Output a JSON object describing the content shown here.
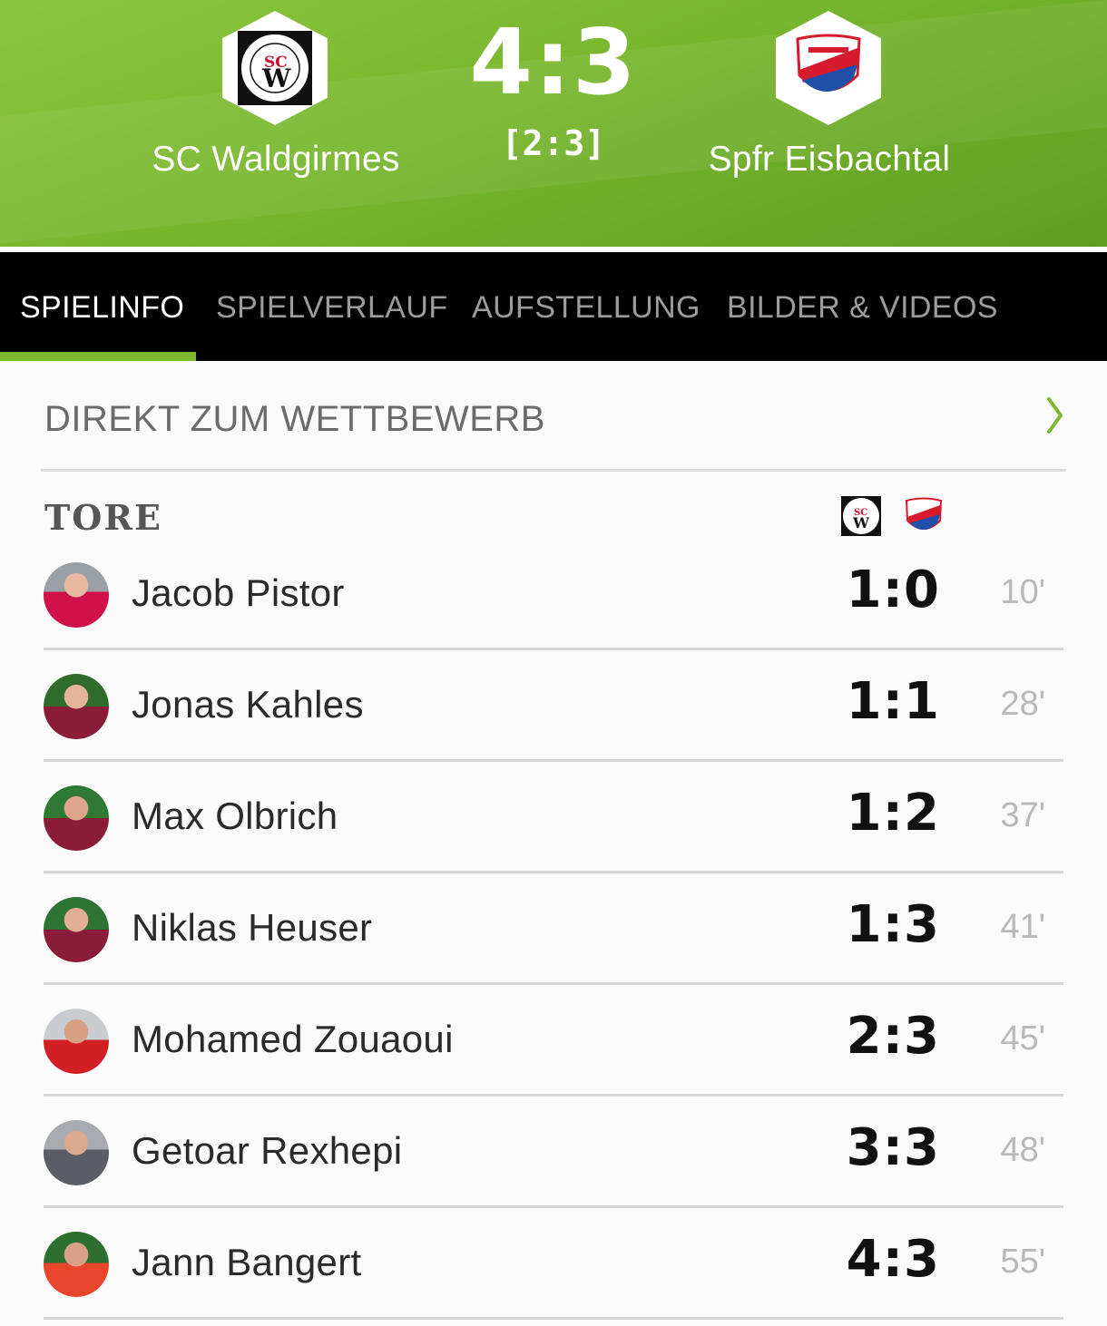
{
  "match": {
    "home_team": "SC Waldgirmes",
    "away_team": "Spfr Eisbachtal",
    "score": "4:3",
    "halftime": "[2:3]"
  },
  "tabs": [
    {
      "label": "SPIELINFO",
      "active": true
    },
    {
      "label": "SPIELVERLAUF",
      "active": false
    },
    {
      "label": "AUFSTELLUNG",
      "active": false
    },
    {
      "label": "BILDER & VIDEOS",
      "active": false
    }
  ],
  "competition_link": {
    "label": "DIREKT ZUM WETTBEWERB",
    "icon": "chevron-right-icon"
  },
  "goals_section": {
    "title": "TORE"
  },
  "goals": [
    {
      "player": "Jacob Pistor",
      "score": "1:0",
      "minute": "10'"
    },
    {
      "player": "Jonas Kahles",
      "score": "1:1",
      "minute": "28'"
    },
    {
      "player": "Max Olbrich",
      "score": "1:2",
      "minute": "37'"
    },
    {
      "player": "Niklas Heuser",
      "score": "1:3",
      "minute": "41'"
    },
    {
      "player": "Mohamed Zouaoui",
      "score": "2:3",
      "minute": "45'"
    },
    {
      "player": "Getoar Rexhepi",
      "score": "3:3",
      "minute": "48'"
    },
    {
      "player": "Jann Bangert",
      "score": "4:3",
      "minute": "55'"
    }
  ],
  "colors": {
    "header_green": "#7cb82f",
    "tab_bg": "#000000",
    "tab_indicator": "#7cb82f",
    "home_shirt": "#c8102e",
    "away_blue": "#1f4fa8"
  }
}
